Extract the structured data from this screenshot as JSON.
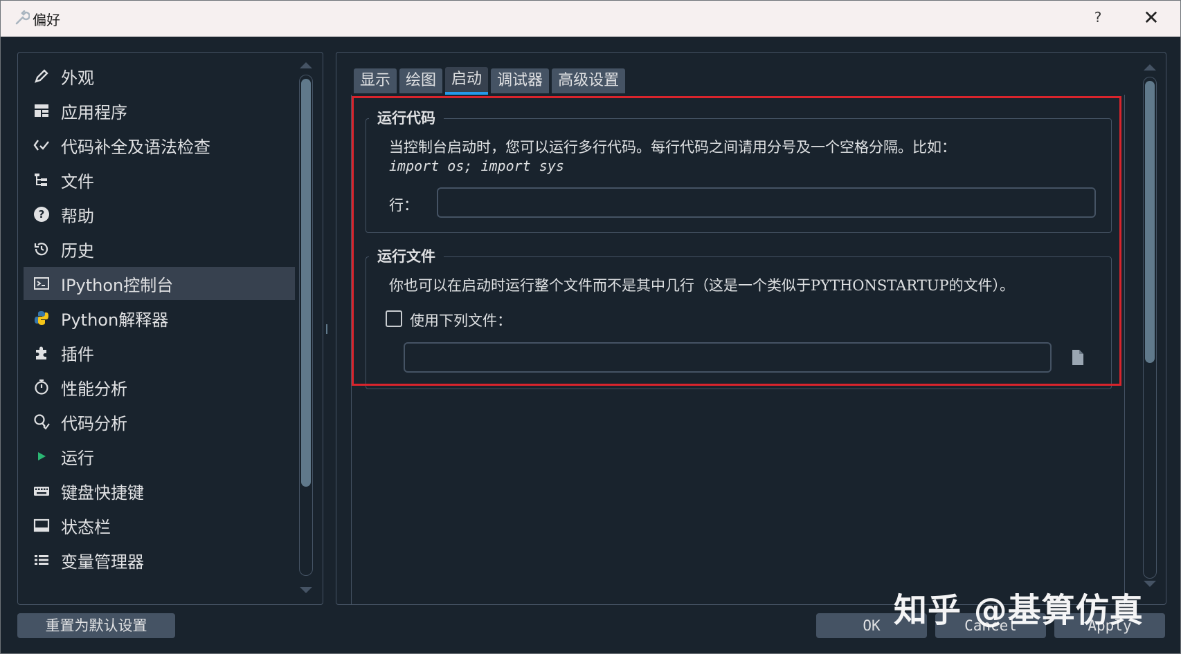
{
  "window": {
    "title": "偏好",
    "help_label": "?",
    "close_label": "✕"
  },
  "nav": {
    "items": [
      {
        "label": "外观",
        "icon": "paint-brush-icon"
      },
      {
        "label": "应用程序",
        "icon": "layout-icon"
      },
      {
        "label": "代码补全及语法检查",
        "icon": "code-check-icon"
      },
      {
        "label": "文件",
        "icon": "file-tree-icon"
      },
      {
        "label": "帮助",
        "icon": "help-icon"
      },
      {
        "label": "历史",
        "icon": "history-icon"
      },
      {
        "label": "IPython控制台",
        "icon": "terminal-icon",
        "selected": true
      },
      {
        "label": "Python解释器",
        "icon": "python-icon"
      },
      {
        "label": "插件",
        "icon": "puzzle-icon"
      },
      {
        "label": "性能分析",
        "icon": "stopwatch-icon"
      },
      {
        "label": "代码分析",
        "icon": "code-analysis-icon"
      },
      {
        "label": "运行",
        "icon": "play-icon"
      },
      {
        "label": "键盘快捷键",
        "icon": "keyboard-icon"
      },
      {
        "label": "状态栏",
        "icon": "statusbar-icon"
      },
      {
        "label": "变量管理器",
        "icon": "list-icon"
      }
    ]
  },
  "tabs": [
    {
      "label": "显示"
    },
    {
      "label": "绘图"
    },
    {
      "label": "启动",
      "active": true
    },
    {
      "label": "调试器"
    },
    {
      "label": "高级设置"
    }
  ],
  "run_code": {
    "title": "运行代码",
    "description": "当控制台启动时，您可以运行多行代码。每行代码之间请用分号及一个空格分隔。比如：",
    "example": "import os; import sys",
    "lines_label": "行：",
    "lines_value": ""
  },
  "run_file": {
    "title": "运行文件",
    "description": "你也可以在启动时运行整个文件而不是其中几行（这是一个类似于PYTHONSTARTUP的文件）。",
    "checkbox_label": "使用下列文件：",
    "checkbox_checked": false,
    "file_value": ""
  },
  "footer": {
    "reset_label": "重置为默认设置",
    "ok_label": "OK",
    "cancel_label": "Cancel",
    "apply_label": "Apply"
  },
  "watermark": "知乎 @基算仿真",
  "colors": {
    "accent": "#259ae9",
    "highlight_border": "#d9242c",
    "background": "#19232d"
  }
}
